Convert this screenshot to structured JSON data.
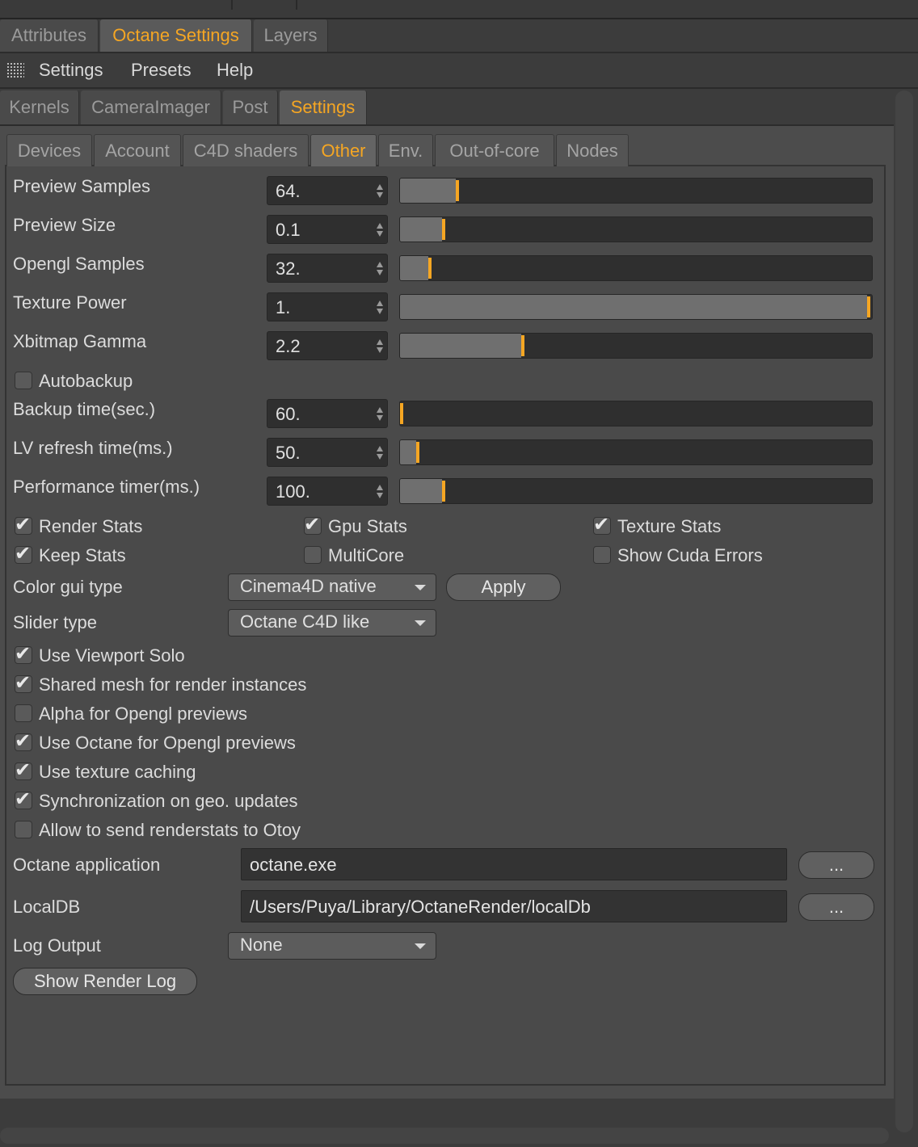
{
  "main_tabs": [
    {
      "label": "Attributes",
      "active": false
    },
    {
      "label": "Octane Settings",
      "active": true
    },
    {
      "label": "Layers",
      "active": false
    }
  ],
  "menu": {
    "items": [
      "Settings",
      "Presets",
      "Help"
    ],
    "icon": "grid-icon"
  },
  "sub_tabs": [
    {
      "label": "Kernels",
      "active": false
    },
    {
      "label": "CameraImager",
      "active": false
    },
    {
      "label": "Post",
      "active": false
    },
    {
      "label": "Settings",
      "active": true
    }
  ],
  "settings_tabs": [
    {
      "label": "Devices",
      "active": false
    },
    {
      "label": "Account",
      "active": false
    },
    {
      "label": "C4D shaders",
      "active": false
    },
    {
      "label": "Other",
      "active": true
    },
    {
      "label": "Env.",
      "active": false
    },
    {
      "label": "Out-of-core",
      "active": false
    },
    {
      "label": "Nodes",
      "active": false
    }
  ],
  "sliders": [
    {
      "label": "Preview Samples",
      "value": "64.",
      "fraction": 0.12
    },
    {
      "label": "Preview Size",
      "value": "0.1",
      "fraction": 0.09
    },
    {
      "label": "Opengl Samples",
      "value": "32.",
      "fraction": 0.06
    },
    {
      "label": "Texture Power",
      "value": "1.",
      "fraction": 1.0
    },
    {
      "label": "Xbitmap Gamma",
      "value": "2.2",
      "fraction": 0.26
    }
  ],
  "autobackup": {
    "label": "Autobackup",
    "checked": false
  },
  "sliders2": [
    {
      "label": "Backup time(sec.)",
      "value": "60.",
      "fraction": 0.0
    },
    {
      "label": "LV refresh time(ms.)",
      "value": "50.",
      "fraction": 0.035
    },
    {
      "label": "Performance timer(ms.)",
      "value": "100.",
      "fraction": 0.09
    }
  ],
  "stats": [
    {
      "label": "Render Stats",
      "checked": true
    },
    {
      "label": "Gpu Stats",
      "checked": true
    },
    {
      "label": "Texture Stats",
      "checked": true
    },
    {
      "label": "Keep Stats",
      "checked": true
    },
    {
      "label": "MultiCore",
      "checked": false
    },
    {
      "label": "Show Cuda Errors",
      "checked": false
    }
  ],
  "color_gui": {
    "label": "Color gui type",
    "value": "Cinema4D native",
    "apply_label": "Apply"
  },
  "slider_type": {
    "label": "Slider type",
    "value": "Octane C4D like"
  },
  "options": [
    {
      "label": "Use Viewport Solo",
      "checked": true
    },
    {
      "label": "Shared mesh for render instances",
      "checked": true
    },
    {
      "label": "Alpha for Opengl previews",
      "checked": false
    },
    {
      "label": "Use Octane for Opengl previews",
      "checked": true
    },
    {
      "label": "Use texture caching",
      "checked": true
    },
    {
      "label": "Synchronization on geo. updates",
      "checked": true
    },
    {
      "label": "Allow to send renderstats to Otoy",
      "checked": false
    }
  ],
  "octane_app": {
    "label": "Octane application",
    "value": "octane.exe",
    "browse_label": "..."
  },
  "localdb": {
    "label": "LocalDB",
    "value": "/Users/Puya/Library/OctaneRender/localDb",
    "browse_label": "..."
  },
  "log_output": {
    "label": "Log Output",
    "value": "None"
  },
  "show_log_label": "Show Render Log",
  "colors": {
    "accent": "#f5a623",
    "panel": "#4a4a4a",
    "field": "#2f2f2f"
  }
}
